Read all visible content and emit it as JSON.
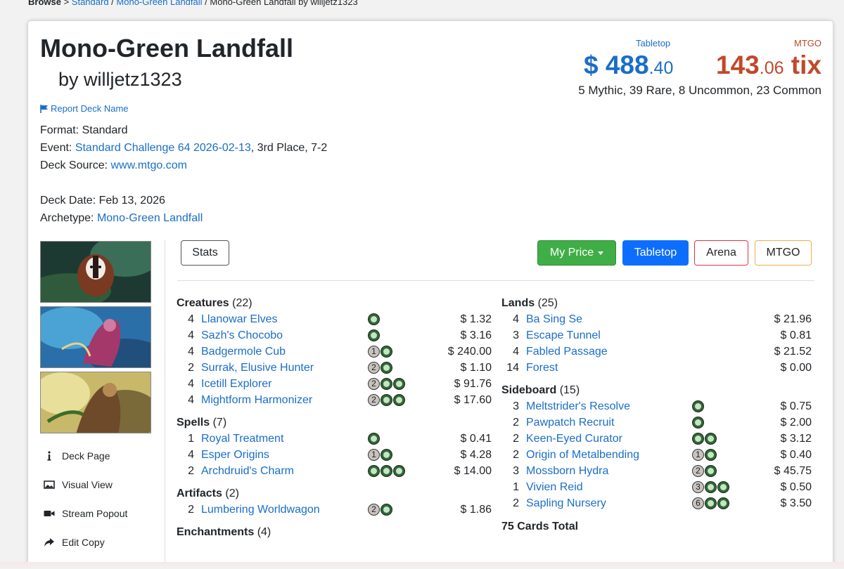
{
  "breadcrumb": {
    "browse": "Browse",
    "sep1": " > ",
    "format": "Standard",
    "sep2": " / ",
    "archetype": "Mono-Green Landfall",
    "sep3": " / ",
    "current": "Mono-Green Landfall by willjetz1323"
  },
  "deck": {
    "title": "Mono-Green Landfall",
    "author": "by willjetz1323",
    "report_link": "Report Deck Name",
    "format_label": "Format:",
    "format_value": "Standard",
    "event_label": "Event:",
    "event_link": "Standard Challenge 64 2026-02-13",
    "event_suffix": ", 3rd Place, 7-2",
    "source_label": "Deck Source:",
    "source_link": "www.mtgo.com",
    "date_label": "Deck Date:",
    "date_value": "Feb 13, 2026",
    "archetype_label": "Archetype:",
    "archetype_link": "Mono-Green Landfall"
  },
  "prices": {
    "tabletop_label": "Tabletop",
    "tabletop_whole": "$ 488",
    "tabletop_cents": ".40",
    "mtgo_label": "MTGO",
    "mtgo_whole": "143",
    "mtgo_cents": ".06",
    "mtgo_unit": " tix",
    "rarity_summary": "5 Mythic, 39 Rare, 8 Uncommon, 23 Common"
  },
  "side_nav": [
    "Deck Page",
    "Visual View",
    "Stream Popout",
    "Edit Copy"
  ],
  "toolbar": {
    "stats": "Stats",
    "my_price": "My Price",
    "tabletop": "Tabletop",
    "arena": "Arena",
    "mtgo": "MTGO"
  },
  "sections_left": [
    {
      "name": "Creatures",
      "count": "(22)",
      "cards": [
        {
          "qty": "4",
          "name": "Llanowar Elves",
          "mana": [
            "G"
          ],
          "price": "$ 1.32"
        },
        {
          "qty": "4",
          "name": "Sazh's Chocobo",
          "mana": [
            "G"
          ],
          "price": "$ 3.16"
        },
        {
          "qty": "4",
          "name": "Badgermole Cub",
          "mana": [
            "1",
            "G"
          ],
          "price": "$ 240.00"
        },
        {
          "qty": "2",
          "name": "Surrak, Elusive Hunter",
          "mana": [
            "2",
            "G"
          ],
          "price": "$ 1.10"
        },
        {
          "qty": "4",
          "name": "Icetill Explorer",
          "mana": [
            "2",
            "G",
            "G"
          ],
          "price": "$ 91.76"
        },
        {
          "qty": "4",
          "name": "Mightform Harmonizer",
          "mana": [
            "2",
            "G",
            "G"
          ],
          "price": "$ 17.60"
        }
      ]
    },
    {
      "name": "Spells",
      "count": "(7)",
      "cards": [
        {
          "qty": "1",
          "name": "Royal Treatment",
          "mana": [
            "G"
          ],
          "price": "$ 0.41"
        },
        {
          "qty": "4",
          "name": "Esper Origins",
          "mana": [
            "1",
            "G"
          ],
          "price": "$ 4.28"
        },
        {
          "qty": "2",
          "name": "Archdruid's Charm",
          "mana": [
            "G",
            "G",
            "G"
          ],
          "price": "$ 14.00"
        }
      ]
    },
    {
      "name": "Artifacts",
      "count": "(2)",
      "cards": [
        {
          "qty": "2",
          "name": "Lumbering Worldwagon",
          "mana": [
            "2",
            "G"
          ],
          "price": "$ 1.86"
        }
      ]
    },
    {
      "name": "Enchantments",
      "count": "(4)",
      "cards": []
    }
  ],
  "sections_right": [
    {
      "name": "Lands",
      "count": "(25)",
      "cards": [
        {
          "qty": "4",
          "name": "Ba Sing Se",
          "mana": [],
          "price": "$ 21.96"
        },
        {
          "qty": "3",
          "name": "Escape Tunnel",
          "mana": [],
          "price": "$ 0.81"
        },
        {
          "qty": "4",
          "name": "Fabled Passage",
          "mana": [],
          "price": "$ 21.52"
        },
        {
          "qty": "14",
          "name": "Forest",
          "mana": [],
          "price": "$ 0.00"
        }
      ]
    },
    {
      "name": "Sideboard",
      "count": "(15)",
      "cards": [
        {
          "qty": "3",
          "name": "Meltstrider's Resolve",
          "mana": [
            "G"
          ],
          "price": "$ 0.75"
        },
        {
          "qty": "2",
          "name": "Pawpatch Recruit",
          "mana": [
            "G"
          ],
          "price": "$ 2.00"
        },
        {
          "qty": "2",
          "name": "Keen-Eyed Curator",
          "mana": [
            "G",
            "G"
          ],
          "price": "$ 3.12"
        },
        {
          "qty": "2",
          "name": "Origin of Metalbending",
          "mana": [
            "1",
            "G"
          ],
          "price": "$ 0.40"
        },
        {
          "qty": "3",
          "name": "Mossborn Hydra",
          "mana": [
            "2",
            "G"
          ],
          "price": "$ 45.75"
        },
        {
          "qty": "1",
          "name": "Vivien Reid",
          "mana": [
            "3",
            "G",
            "G"
          ],
          "price": "$ 0.50"
        },
        {
          "qty": "2",
          "name": "Sapling Nursery",
          "mana": [
            "6",
            "G",
            "G"
          ],
          "price": "$ 3.50"
        }
      ]
    }
  ],
  "total": "75 Cards Total",
  "colors": {
    "link": "#1a6ec7",
    "mtgo": "#c0492a",
    "my_price_bg": "#3fae46",
    "tabletop_bg": "#0d6efd",
    "arena_border": "#dc3545",
    "mtgo_border": "#f0ad4e",
    "green_mana": "#2d6a34"
  }
}
